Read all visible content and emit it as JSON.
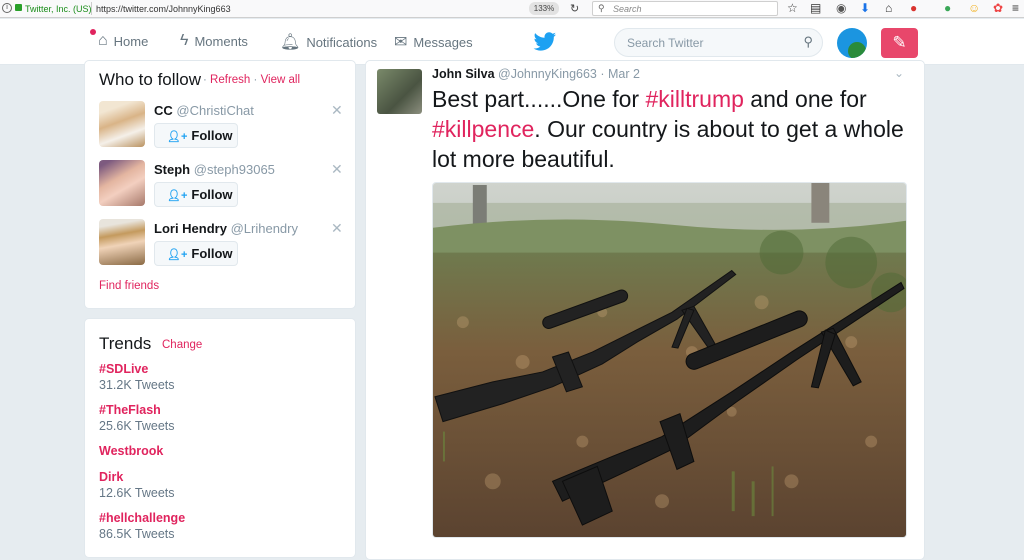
{
  "browser": {
    "site_identity": "Twitter, Inc. (US)",
    "url": "https://twitter.com/JohnnyKing663",
    "zoom": "133%",
    "search_placeholder": "Search"
  },
  "nav": {
    "home": "Home",
    "moments": "Moments",
    "notifications": "Notifications",
    "messages": "Messages",
    "search_placeholder": "Search Twitter"
  },
  "who_to_follow": {
    "title": "Who to follow",
    "refresh": "Refresh",
    "view_all": "View all",
    "sep": "·",
    "follow_label": "Follow",
    "find_friends": "Find friends",
    "users": [
      {
        "name": "CC",
        "handle": "@ChristiChat"
      },
      {
        "name": "Steph",
        "handle": "@steph93065"
      },
      {
        "name": "Lori Hendry",
        "handle": "@Lrihendry"
      }
    ]
  },
  "trends": {
    "title": "Trends",
    "change": "Change",
    "items": [
      {
        "tag": "#SDLive",
        "count": "31.2K Tweets"
      },
      {
        "tag": "#TheFlash",
        "count": "25.6K Tweets"
      },
      {
        "tag": "Westbrook",
        "count": ""
      },
      {
        "tag": "Dirk",
        "count": "12.6K Tweets"
      },
      {
        "tag": "#hellchallenge",
        "count": "86.5K Tweets"
      }
    ]
  },
  "tweet": {
    "name": "John Silva",
    "handle": "@JohnnyKing663",
    "date": "· Mar 2",
    "text_parts": [
      "Best part......One for ",
      "#killtrump",
      " and one for ",
      "#killpence",
      ". Our country is about to get a whole lot more beautiful."
    ]
  },
  "colors": {
    "accent": "#e0245e",
    "twitter_blue": "#1da1f2",
    "background": "#e6ecf0"
  }
}
